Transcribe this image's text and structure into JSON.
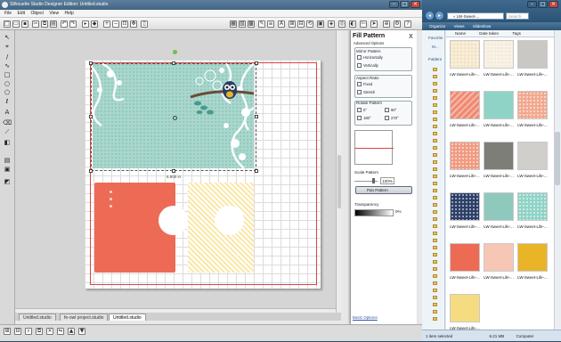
{
  "app": {
    "title": "Silhouette Studio Designer Edition: Untitled.studio",
    "menu": [
      "File",
      "Edit",
      "Object",
      "View",
      "Help"
    ],
    "doc_tabs": [
      "Untitled.studio",
      "fe-owl project.studio",
      "Untitled.studio"
    ],
    "active_tab_index": 2
  },
  "fill_panel": {
    "title": "Fill Pattern",
    "close": "X",
    "advanced": "Advanced Options",
    "mirror_title": "Mirror Pattern",
    "mirror_h": "Horizontally",
    "mirror_v": "Vertically",
    "aspect_title": "Aspect Ratio",
    "aspect_fixed": "Fixed",
    "aspect_stretch": "Stretch",
    "rotate_title": "Rotate Pattern",
    "rot_0": "0°",
    "rot_90": "90°",
    "rot_180": "180°",
    "rot_270": "270°",
    "scale_title": "Scale Pattern",
    "scale_value": "100%",
    "pan_button": "Pan Pattern",
    "transparency_title": "Transparency",
    "transparency_value": "0%",
    "basic_link": "Basic Options"
  },
  "canvas": {
    "measure": "6.500 in"
  },
  "explorer": {
    "address": "« LW-Sweet-...",
    "search_placeholder": "Search",
    "toolbar": [
      "Organize",
      "Views",
      "Slideshow"
    ],
    "columns": [
      "Name",
      "Date taken",
      "Tags"
    ],
    "favorites": "Favorite",
    "fav_more": "M...",
    "folders": "Folders",
    "item_label": "LW-Sweet-Life-...",
    "items": [
      {
        "color": "#f5e6c9",
        "pattern": "polka"
      },
      {
        "color": "#f6eedd",
        "pattern": "dots"
      },
      {
        "color": "#c9c8c4",
        "pattern": "solid"
      },
      {
        "color": "#ee8a74",
        "pattern": "chevron"
      },
      {
        "color": "#8fd3c6",
        "pattern": "solid"
      },
      {
        "color": "#f2a88e",
        "pattern": "dots"
      },
      {
        "color": "#f19a80",
        "pattern": "dots"
      },
      {
        "color": "#7d7e78",
        "pattern": "solid"
      },
      {
        "color": "#d1cfcb",
        "pattern": "solid"
      },
      {
        "color": "#2b3e66",
        "pattern": "dots"
      },
      {
        "color": "#8fc9bd",
        "pattern": "solid"
      },
      {
        "color": "#8fd3c6",
        "pattern": "dots"
      },
      {
        "color": "#ed6b55",
        "pattern": "solid"
      },
      {
        "color": "#f7c6b5",
        "pattern": "solid"
      },
      {
        "color": "#e9b427",
        "pattern": "solid"
      },
      {
        "color": "#f5dc80",
        "pattern": "solid"
      }
    ],
    "status_selected": "1 item selected",
    "status_size": "6.21 MB",
    "status_location": "Computer"
  }
}
